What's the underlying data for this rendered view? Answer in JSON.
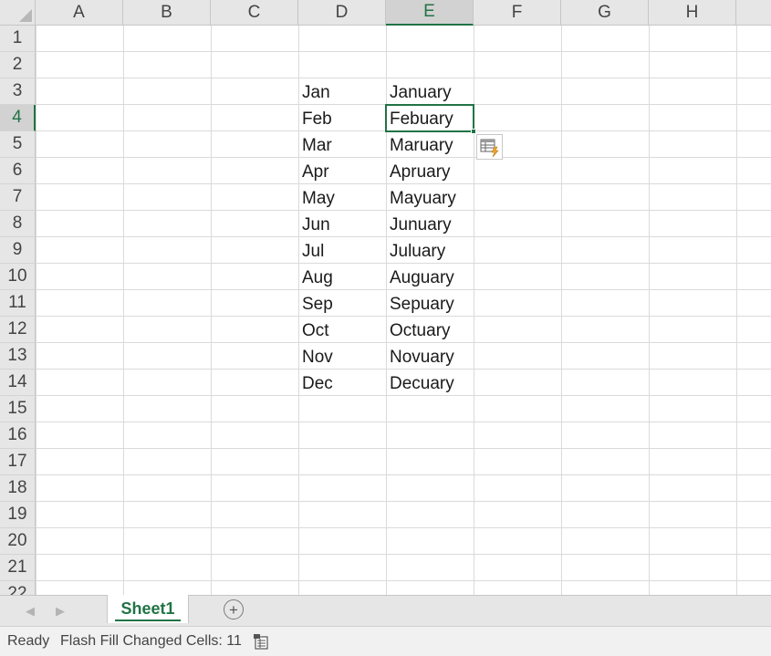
{
  "columns": [
    {
      "label": "A",
      "selected": false
    },
    {
      "label": "B",
      "selected": false
    },
    {
      "label": "C",
      "selected": false
    },
    {
      "label": "D",
      "selected": false
    },
    {
      "label": "E",
      "selected": true
    },
    {
      "label": "F",
      "selected": false
    },
    {
      "label": "G",
      "selected": false
    },
    {
      "label": "H",
      "selected": false
    }
  ],
  "rows": [
    "1",
    "2",
    "3",
    "4",
    "5",
    "6",
    "7",
    "8",
    "9",
    "10",
    "11",
    "12",
    "13",
    "14",
    "15",
    "16",
    "17",
    "18",
    "19",
    "20",
    "21",
    "22"
  ],
  "active_row": "4",
  "active_cell": "E4",
  "cells": {
    "D": [
      "Jan",
      "Feb",
      "Mar",
      "Apr",
      "May",
      "Jun",
      "Jul",
      "Aug",
      "Sep",
      "Oct",
      "Nov",
      "Dec"
    ],
    "E": [
      "January",
      "Febuary",
      "Maruary",
      "Apruary",
      "Mayuary",
      "Junuary",
      "Juluary",
      "Auguary",
      "Sepuary",
      "Octuary",
      "Novuary",
      "Decuary"
    ]
  },
  "sheet_tabs": [
    {
      "label": "Sheet1",
      "active": true
    }
  ],
  "status": {
    "ready": "Ready",
    "message": "Flash Fill Changed Cells: 11"
  },
  "colors": {
    "accent": "#217346",
    "header_bg": "#e6e6e6",
    "gridline": "#dadada"
  },
  "icons": {
    "flash_fill_options": "flash-fill-options-icon",
    "add_sheet": "plus-circle-icon",
    "status_page": "sheet-stats-icon"
  }
}
